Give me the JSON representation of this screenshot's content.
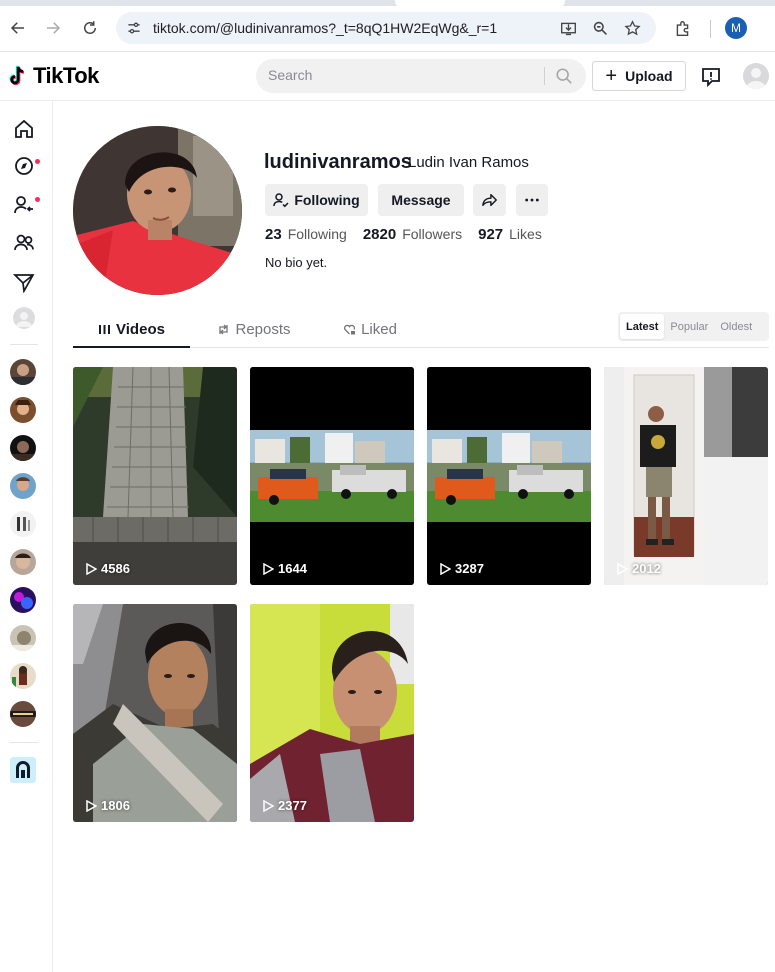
{
  "browser": {
    "url": "tiktok.com/@ludinivanramos?_t=8qQ1HW2EqWg&_r=1",
    "profile_initial": "M"
  },
  "header": {
    "brand": "TikTok",
    "search_placeholder": "Search",
    "upload_label": "Upload"
  },
  "profile": {
    "username": "ludinivanramos",
    "nickname": "Ludin Ivan Ramos",
    "following_label": "Following",
    "message_label": "Message",
    "stats": [
      {
        "value": "23",
        "label": "Following"
      },
      {
        "value": "2820",
        "label": "Followers"
      },
      {
        "value": "927",
        "label": "Likes"
      }
    ],
    "bio": "No bio yet."
  },
  "tabs": [
    {
      "label": "Videos",
      "active": true
    },
    {
      "label": "Reposts",
      "active": false
    },
    {
      "label": "Liked",
      "active": false
    }
  ],
  "sort_options": [
    {
      "label": "Latest",
      "active": true
    },
    {
      "label": "Popular",
      "active": false
    },
    {
      "label": "Oldest",
      "active": false
    }
  ],
  "videos": [
    {
      "views": "4586",
      "thumb": "paver-walkway"
    },
    {
      "views": "1644",
      "thumb": "truck-trailer"
    },
    {
      "views": "3287",
      "thumb": "truck-trailer"
    },
    {
      "views": "2012",
      "thumb": "man-doorway"
    },
    {
      "views": "1806",
      "thumb": "selfie-car"
    },
    {
      "views": "2377",
      "thumb": "selfie-green-wall"
    }
  ],
  "colors": {
    "brand_accent": "#fe2c55",
    "text_primary": "#161823",
    "button_grey": "#efeff0"
  }
}
